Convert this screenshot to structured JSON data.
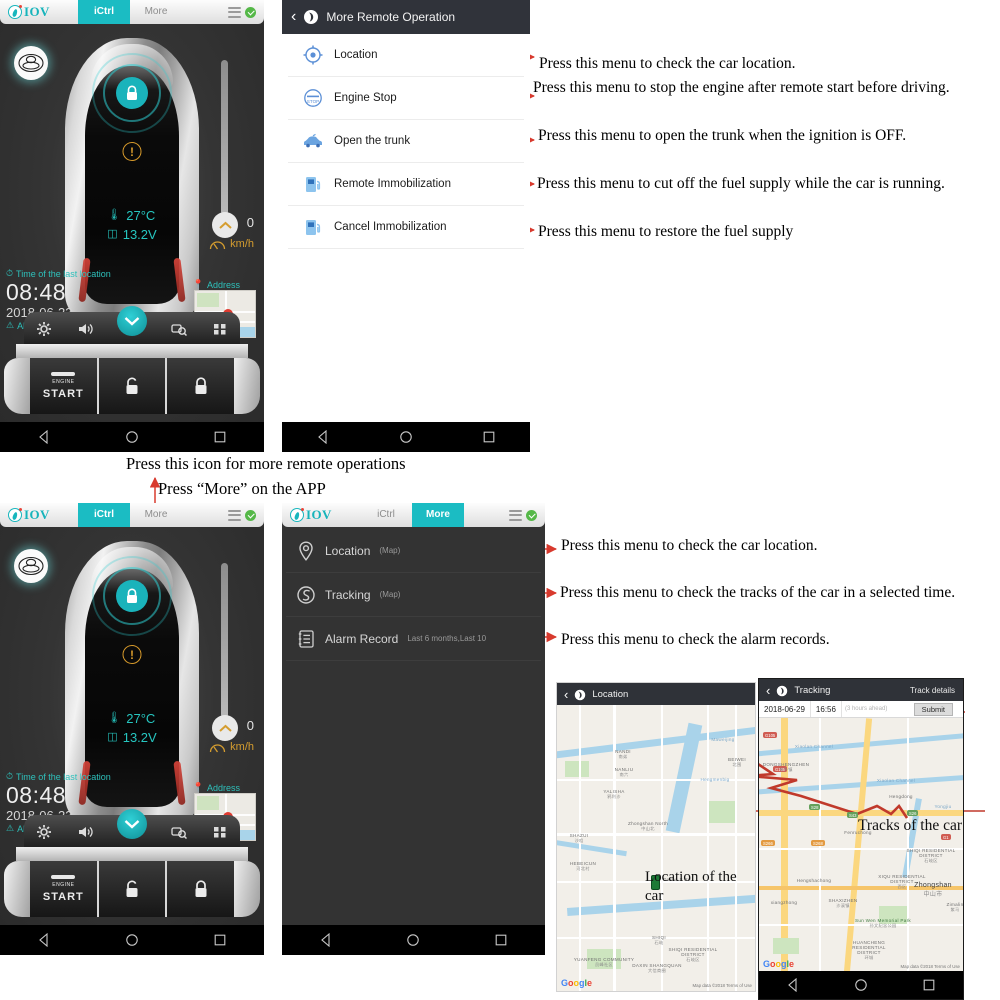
{
  "app": {
    "brand": "IOV",
    "tabs": [
      {
        "label": "iCtrl",
        "active_top": true
      },
      {
        "label": "More",
        "active_top": false
      }
    ],
    "tabs_bottom": [
      {
        "label": "iCtrl",
        "active": false
      },
      {
        "label": "More",
        "active": true
      }
    ],
    "dashboard": {
      "temperature": "27°C",
      "voltage": "13.2V",
      "speed_value": "0",
      "speed_unit": "km/h",
      "last_location_label": "Time of the last location",
      "time": "08:48",
      "date": "2018-06-23",
      "alarm_type_label": "Alarm type",
      "address_label": "Address",
      "engine_small": "ENGINE",
      "engine_big": "START"
    }
  },
  "remote_panel": {
    "title": "More Remote Operation",
    "items": [
      {
        "label": "Location",
        "icon": "crosshair-location-icon"
      },
      {
        "label": "Engine Stop",
        "icon": "stop-sign-icon"
      },
      {
        "label": "Open the trunk",
        "icon": "car-trunk-icon"
      },
      {
        "label": "Remote Immobilization",
        "icon": "fuel-pump-icon"
      },
      {
        "label": "Cancel Immobilization",
        "icon": "fuel-pump-icon"
      }
    ]
  },
  "remote_annotations": [
    "Press this menu to check the car location.",
    "Press this menu to stop the engine after remote start before driving.",
    "Press this menu to open the trunk when the ignition is OFF.",
    "Press this menu to cut off the fuel supply while the car is running.",
    "Press this menu to restore the fuel supply"
  ],
  "captions": {
    "more_icon": "Press this icon for more remote operations",
    "more_tab": "Press “More” on the APP"
  },
  "more_panel": {
    "items": [
      {
        "label": "Location",
        "sub": "(Map)",
        "icon": "map-pin-icon"
      },
      {
        "label": "Tracking",
        "sub": "(Map)",
        "icon": "track-swirl-icon"
      },
      {
        "label": "Alarm Record",
        "sub": "Last 6 months,Last 10",
        "icon": "record-list-icon"
      }
    ]
  },
  "more_annotations": [
    "Press this menu to check the car location.",
    "Press this menu to check the tracks of the car in a selected time.",
    "Press this menu to check the alarm records."
  ],
  "location_map": {
    "title": "Location",
    "callout": "Location of the car",
    "watermark": "Google",
    "attribution": "Map data ©2018   Terms of Use",
    "labels": [
      {
        "en": "NANDI",
        "cn": "南弟"
      },
      {
        "en": "NANLIU",
        "cn": "南六"
      },
      {
        "en": "YALISHA",
        "cn": "鸦利沙"
      },
      {
        "en": "BEIWEI",
        "cn": "北围"
      },
      {
        "en": "SHAZUI",
        "cn": "沙咀"
      },
      {
        "en": "HEBEICUN",
        "cn": "河北村"
      },
      {
        "en": "SHIQI",
        "cn": "石岐"
      },
      {
        "en": "YUANFENG COMMUNITY",
        "cn": "员峰社区"
      },
      {
        "en": "DAXIN SHANGQUAN",
        "cn": "大信商圈"
      },
      {
        "en": "SHIQI RESIDENTIAL DISTRICT",
        "cn": "石岐区"
      },
      {
        "en": "Zhongshan North",
        "cn": "中山北"
      },
      {
        "en": "Maweijing",
        "cn": ""
      },
      {
        "en": "Hengmenbig",
        "cn": ""
      },
      {
        "en": "Dasha S Rd",
        "cn": ""
      }
    ]
  },
  "tracking_map": {
    "title": "Tracking",
    "track_details": "Track details",
    "date": "2018-06-29",
    "time": "16:56",
    "note": "(3 hours ahead)",
    "submit": "Submit",
    "callout": "Tracks of the car",
    "watermark": "Google",
    "attribution": "Map data ©2018   Terms of Use",
    "labels": [
      {
        "en": "DONGSHENGZHEN",
        "cn": "东升镇"
      },
      {
        "en": "SHIQI RESIDENTIAL DISTRICT",
        "cn": "石岐区"
      },
      {
        "en": "XIQU RESIDENTIAL DISTRICT",
        "cn": "西区"
      },
      {
        "en": "SHAXIZHEN",
        "cn": "沙溪镇"
      },
      {
        "en": "HUANCHENG RESIDENTIAL DISTRICT",
        "cn": "环城"
      },
      {
        "en": "Zhongshan",
        "cn": "中山市"
      },
      {
        "en": "Zimalin",
        "cn": "紫马"
      },
      {
        "en": "Sun Wen Memorial Park",
        "cn": "孙文纪念公园"
      },
      {
        "en": "Hengdong",
        "cn": ""
      },
      {
        "en": "Yongjiu",
        "cn": ""
      },
      {
        "en": "Fenruchong",
        "cn": ""
      },
      {
        "en": "Hengshachong",
        "cn": ""
      },
      {
        "en": "Xiangzhong",
        "cn": ""
      }
    ],
    "shields": [
      "G105",
      "G105",
      "S28",
      "S43",
      "S26",
      "G105",
      "S43",
      "S268",
      "S266",
      "S28"
    ]
  },
  "navbar": {
    "back": "back-triangle-icon",
    "home": "home-circle-icon",
    "recents": "recents-square-icon"
  },
  "colors": {
    "accent": "#1bbcc3",
    "arrow_red": "#d83a2e",
    "dark_panel": "#30333a",
    "app_bg": "#333333"
  }
}
